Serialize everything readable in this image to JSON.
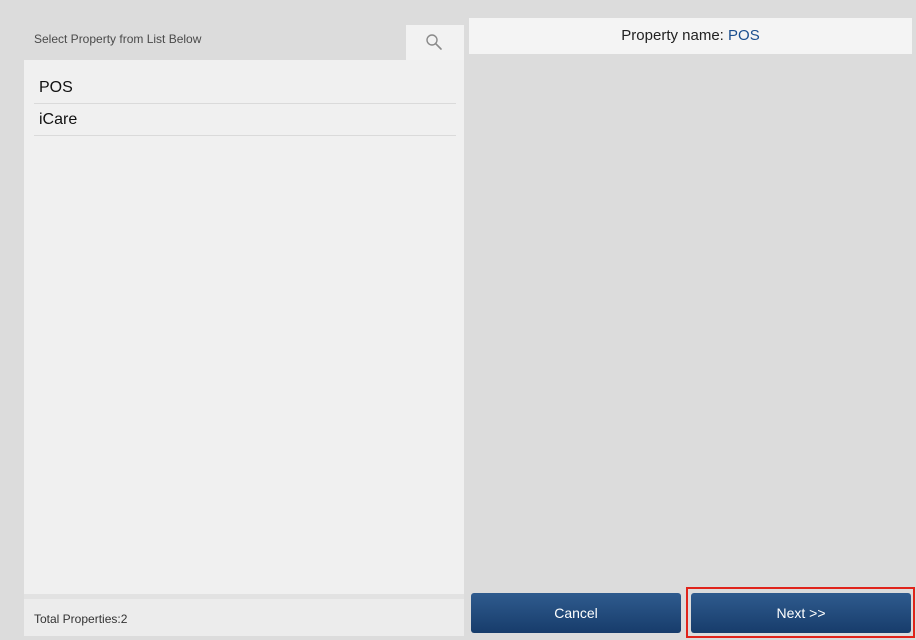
{
  "left_panel": {
    "header_title": "Select Property from List Below",
    "search_icon": "search-icon",
    "properties": [
      "POS",
      "iCare"
    ],
    "footer_text": "Total Properties:2"
  },
  "right_panel": {
    "property_label": "Property name: ",
    "property_value": "POS"
  },
  "buttons": {
    "cancel_label": "Cancel",
    "next_label": "Next >>"
  },
  "colors": {
    "button": "#1f4677",
    "highlight": "#e0241b",
    "property_value": "#1b4f8f"
  }
}
